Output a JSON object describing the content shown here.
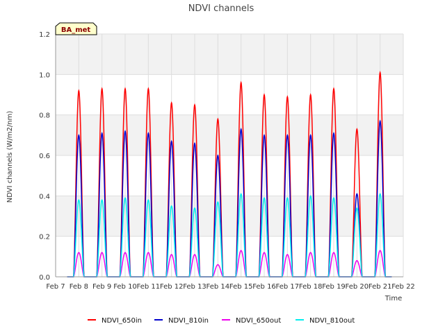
{
  "chart_data": {
    "type": "line",
    "title": "NDVI channels",
    "xlabel": "Time",
    "ylabel": "NDVI channels (W/m2/nm)",
    "badge": "BA_met",
    "ylim": [
      0,
      1.2
    ],
    "yticks": [
      "0.0",
      "0.2",
      "0.4",
      "0.6",
      "0.8",
      "1.0",
      "1.2"
    ],
    "xlim": [
      7,
      22
    ],
    "xticks": [
      "Feb 7",
      "Feb 8",
      "Feb 9",
      "Feb 10",
      "Feb 11",
      "Feb 12",
      "Feb 13",
      "Feb 14",
      "Feb 15",
      "Feb 16",
      "Feb 17",
      "Feb 18",
      "Feb 19",
      "Feb 20",
      "Feb 21",
      "Feb 22"
    ],
    "data_start_day": 7.5,
    "data_end_day": 21.5,
    "grid": true,
    "legend_position": "bottom",
    "peak_days": [
      8.0,
      9.0,
      10.0,
      11.0,
      12.0,
      13.0,
      14.0,
      15.0,
      16.0,
      17.0,
      18.0,
      19.0,
      20.0,
      21.0
    ],
    "series": [
      {
        "name": "NDVI_650in",
        "color": "#ff0000",
        "peaks": [
          0.92,
          0.93,
          0.93,
          0.93,
          0.86,
          0.85,
          0.78,
          0.96,
          0.9,
          0.89,
          0.9,
          0.93,
          0.73,
          1.01
        ]
      },
      {
        "name": "NDVI_810in",
        "color": "#0000cc",
        "peaks": [
          0.7,
          0.71,
          0.72,
          0.71,
          0.67,
          0.66,
          0.6,
          0.73,
          0.7,
          0.7,
          0.7,
          0.71,
          0.41,
          0.77
        ]
      },
      {
        "name": "NDVI_650out",
        "color": "#ee00ee",
        "peaks": [
          0.12,
          0.12,
          0.12,
          0.12,
          0.11,
          0.11,
          0.06,
          0.13,
          0.12,
          0.11,
          0.12,
          0.12,
          0.08,
          0.13
        ]
      },
      {
        "name": "NDVI_810out",
        "color": "#00eeee",
        "peaks": [
          0.38,
          0.38,
          0.39,
          0.38,
          0.35,
          0.34,
          0.37,
          0.41,
          0.39,
          0.39,
          0.4,
          0.39,
          0.34,
          0.41
        ]
      }
    ]
  }
}
